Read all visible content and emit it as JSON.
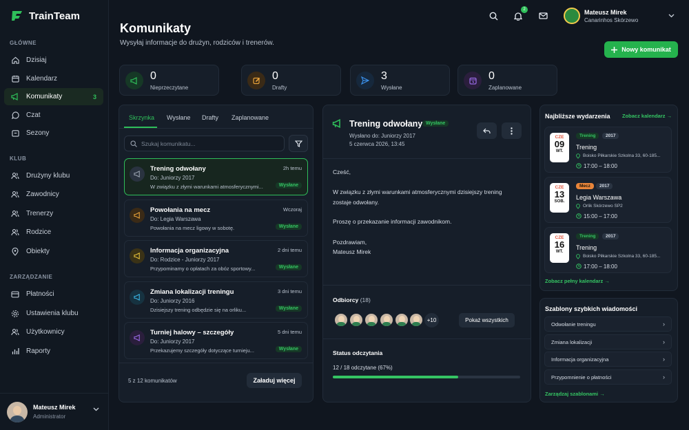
{
  "app": {
    "name": "TrainTeam"
  },
  "sidebar": {
    "sections": [
      "GŁÓWNE",
      "KLUB",
      "ZARZĄDZANIE"
    ],
    "items": [
      {
        "label": "Dzisiaj",
        "icon": "home-icon"
      },
      {
        "label": "Kalendarz",
        "icon": "calendar-icon"
      },
      {
        "label": "Komunikaty",
        "icon": "megaphone-icon",
        "badge": "3"
      },
      {
        "label": "Czat",
        "icon": "chat-icon"
      },
      {
        "label": "Sezony",
        "icon": "trophy-icon"
      },
      {
        "label": "Drużyny klubu",
        "icon": "users-icon"
      },
      {
        "label": "Zawodnicy",
        "icon": "users-icon"
      },
      {
        "label": "Trenerzy",
        "icon": "users-icon"
      },
      {
        "label": "Rodzice",
        "icon": "users-icon"
      },
      {
        "label": "Obiekty",
        "icon": "location-icon"
      },
      {
        "label": "Płatności",
        "icon": "card-icon"
      },
      {
        "label": "Ustawienia klubu",
        "icon": "gear-icon"
      },
      {
        "label": "Użytkownicy",
        "icon": "users-icon"
      },
      {
        "label": "Raporty",
        "icon": "chart-icon"
      }
    ],
    "user": {
      "name": "Mateusz Mirek",
      "role": "Administrator"
    }
  },
  "topbar": {
    "notif_count": "2",
    "user_name": "Mateusz Mirek",
    "club": "Canarinhos Skórzewo"
  },
  "page": {
    "title": "Komunikaty",
    "subtitle": "Wysyłaj informacje do drużyn, rodziców i trenerów.",
    "new_button": "Nowy komunikat"
  },
  "stats": [
    {
      "value": "0",
      "label": "Nieprzeczytane",
      "color": "#2fbf5a"
    },
    {
      "value": "0",
      "label": "Drafty",
      "color": "#e8a23a"
    },
    {
      "value": "3",
      "label": "Wysłane",
      "color": "#3a8fe8"
    },
    {
      "value": "0",
      "label": "Zaplanowane",
      "color": "#9b6be8"
    }
  ],
  "inbox": {
    "tabs": [
      "Skrzynka",
      "Wysłane",
      "Drafty",
      "Zaplanowane"
    ],
    "search_placeholder": "Szukaj komunikatu...",
    "messages": [
      {
        "title": "Trening odwołany",
        "time": "2h temu",
        "to": "Do: Juniorzy 2017",
        "preview": "W związku z złymi warunkami atmosferycznymi...",
        "status": "Wysłane",
        "color": "#2fbf5a"
      },
      {
        "title": "Powołania na mecz",
        "time": "Wczoraj",
        "to": "Do: Legia Warszawa",
        "preview": "Powołania na mecz ligowy w sobotę.",
        "status": "Wysłane",
        "color": "#e8a23a"
      },
      {
        "title": "Informacja organizacyjna",
        "time": "2 dni temu",
        "to": "Do: Rodzice - Juniorzy 2017",
        "preview": "Przypominamy o opłatach za obóz sportowy...",
        "status": "Wysłane",
        "color": "#e8c23a"
      },
      {
        "title": "Zmiana lokalizacji treningu",
        "time": "3 dni temu",
        "to": "Do: Juniorzy 2016",
        "preview": "Dzisiejszy trening odbędzie się na orliku...",
        "status": "Wysłane",
        "color": "#3ab8e8"
      },
      {
        "title": "Turniej halowy – szczegóły",
        "time": "5 dni temu",
        "to": "Do: Juniorzy 2017",
        "preview": "Przekazujemy szczegóły dotyczące turnieju...",
        "status": "Wysłane",
        "color": "#9b6be8"
      }
    ],
    "footer_count": "5 z 12 komunikatów",
    "load_more": "Załaduj więcej"
  },
  "detail": {
    "title": "Trening odwołany",
    "status": "Wysłane",
    "sent_to": "Wysłano do: Juniorzy 2017",
    "date": "5 czerwca 2026, 13:45",
    "body": [
      "Cześć,",
      "W związku z złymi warunkami atmosferycznymi dzisiejszy trening zostaje odwołany.",
      "Proszę o przekazanie informacji zawodnikom.",
      "Pozdrawiam,",
      "Mateusz Mirek"
    ],
    "recipients_label": "Odbiorcy",
    "recipients_count": "(18)",
    "more_recipients": "+10",
    "show_all": "Pokaż wszystkich",
    "read_status_label": "Status odczytania",
    "read_text": "12 / 18 odczytane (67%)",
    "read_fraction": 0.67
  },
  "events": {
    "title": "Najbliższe wydarzenia",
    "calendar_link": "Zobacz kalendarz",
    "items": [
      {
        "month": "CZE",
        "day": "09",
        "weekday": "WT.",
        "type": "Trening",
        "year_tag": "2017",
        "name": "Trening",
        "address": "Boisko Piłkarskie Szkolna 33, 60-185...",
        "time": "17:00 – 18:00",
        "type_color": "#2fbf5a"
      },
      {
        "month": "CZE",
        "day": "13",
        "weekday": "SOB.",
        "type": "Mecz",
        "year_tag": "2017",
        "name": "Legia Warszawa",
        "address": "Orlik Skórzewo SP2",
        "time": "15:00 – 17:00",
        "type_color": "#e8853a"
      },
      {
        "month": "CZE",
        "day": "16",
        "weekday": "WT.",
        "type": "Trening",
        "year_tag": "2017",
        "name": "Trening",
        "address": "Boisko Piłkarskie Szkolna 33, 60-185...",
        "time": "17:00 – 18:00",
        "type_color": "#2fbf5a"
      }
    ],
    "full_link": "Zobacz pełny kalendarz"
  },
  "templates": {
    "title": "Szablony szybkich wiadomości",
    "items": [
      "Odwołanie treningu",
      "Zmiana lokalizacji",
      "Informacja organizacyjna",
      "Przypomnienie o płatności"
    ],
    "manage_link": "Zarządzaj szablonami"
  }
}
